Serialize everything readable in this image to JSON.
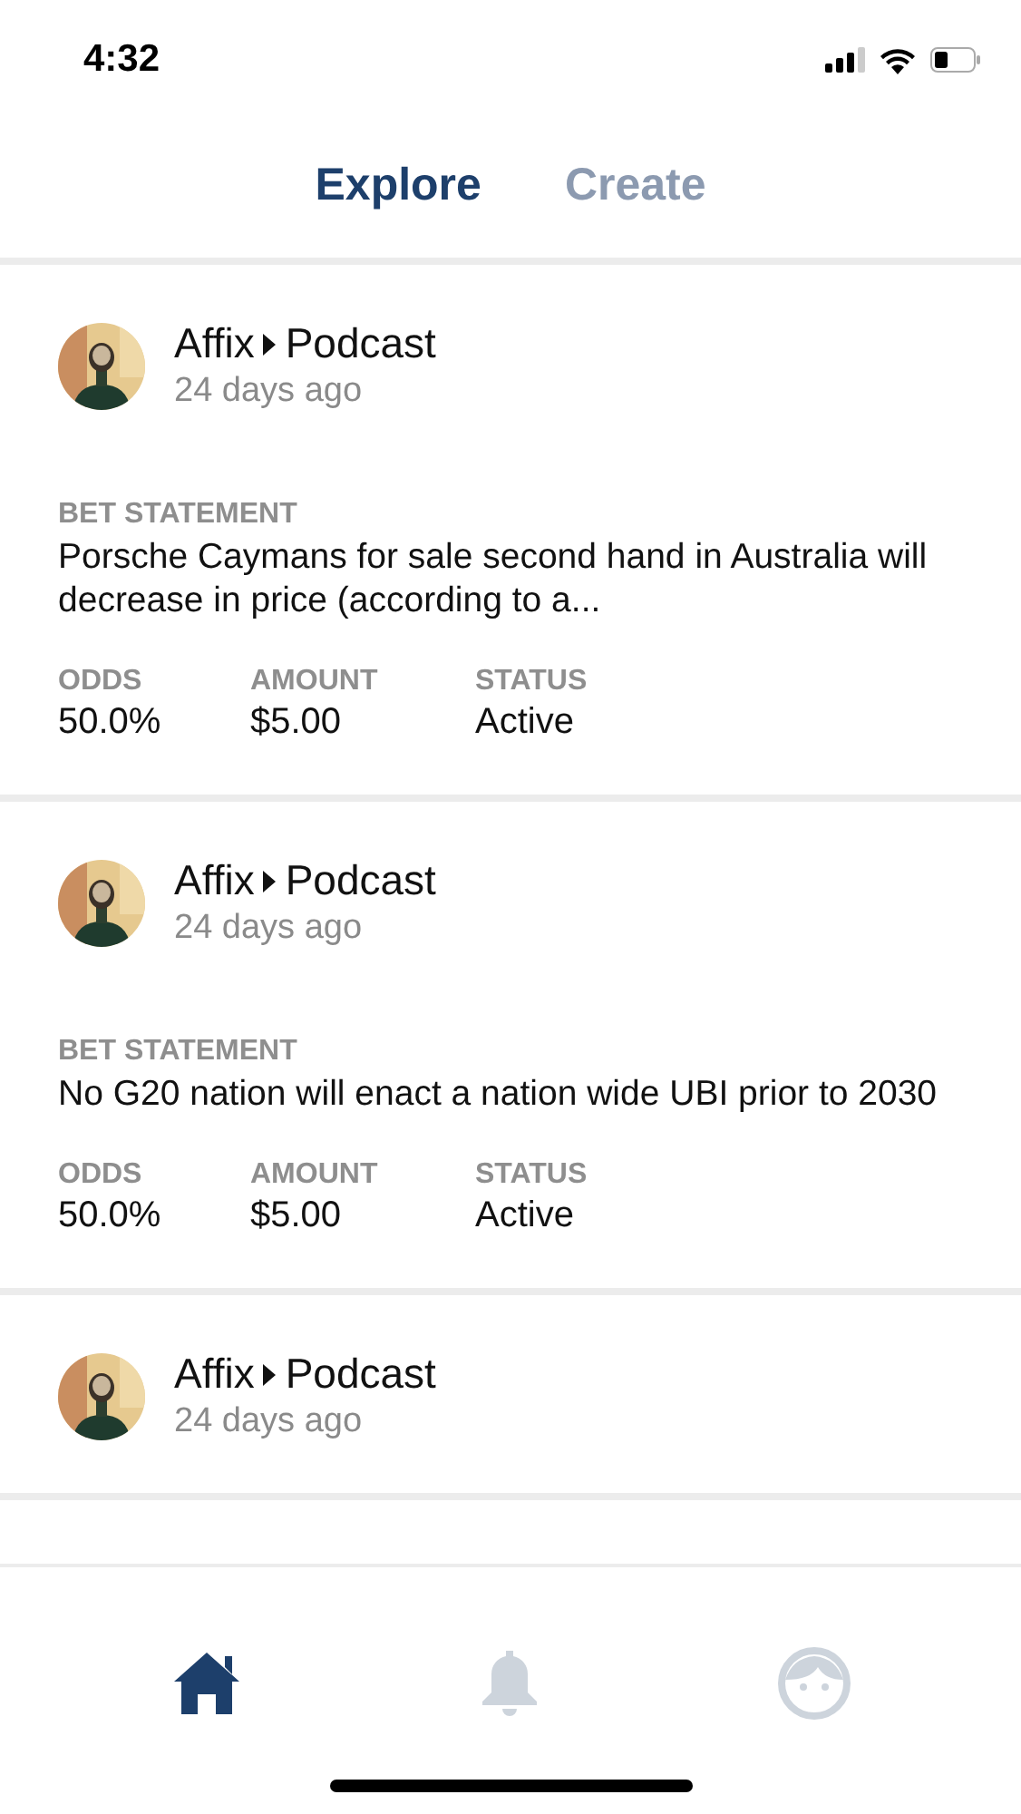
{
  "status_bar": {
    "time": "4:32"
  },
  "tabs": [
    {
      "label": "Explore",
      "selected": true
    },
    {
      "label": "Create",
      "selected": false
    }
  ],
  "feed": [
    {
      "author": "Affix",
      "channel": "Podcast",
      "time": "24 days ago",
      "statement_label": "BET STATEMENT",
      "statement": "Porsche Caymans for sale second hand in Australia will decrease in price (according to a...",
      "stats": [
        {
          "label": "ODDS",
          "value": "50.0%"
        },
        {
          "label": "AMOUNT",
          "value": "$5.00"
        },
        {
          "label": "STATUS",
          "value": "Active"
        }
      ]
    },
    {
      "author": "Affix",
      "channel": "Podcast",
      "time": "24 days ago",
      "statement_label": "BET STATEMENT",
      "statement": "No G20 nation will enact a nation wide UBI prior to 2030",
      "stats": [
        {
          "label": "ODDS",
          "value": "50.0%"
        },
        {
          "label": "AMOUNT",
          "value": "$5.00"
        },
        {
          "label": "STATUS",
          "value": "Active"
        }
      ]
    },
    {
      "author": "Affix",
      "channel": "Podcast",
      "time": "24 days ago"
    }
  ],
  "bottom_nav": [
    {
      "kind": "home",
      "selected": true
    },
    {
      "kind": "bell",
      "selected": false
    },
    {
      "kind": "profile",
      "selected": false
    }
  ]
}
